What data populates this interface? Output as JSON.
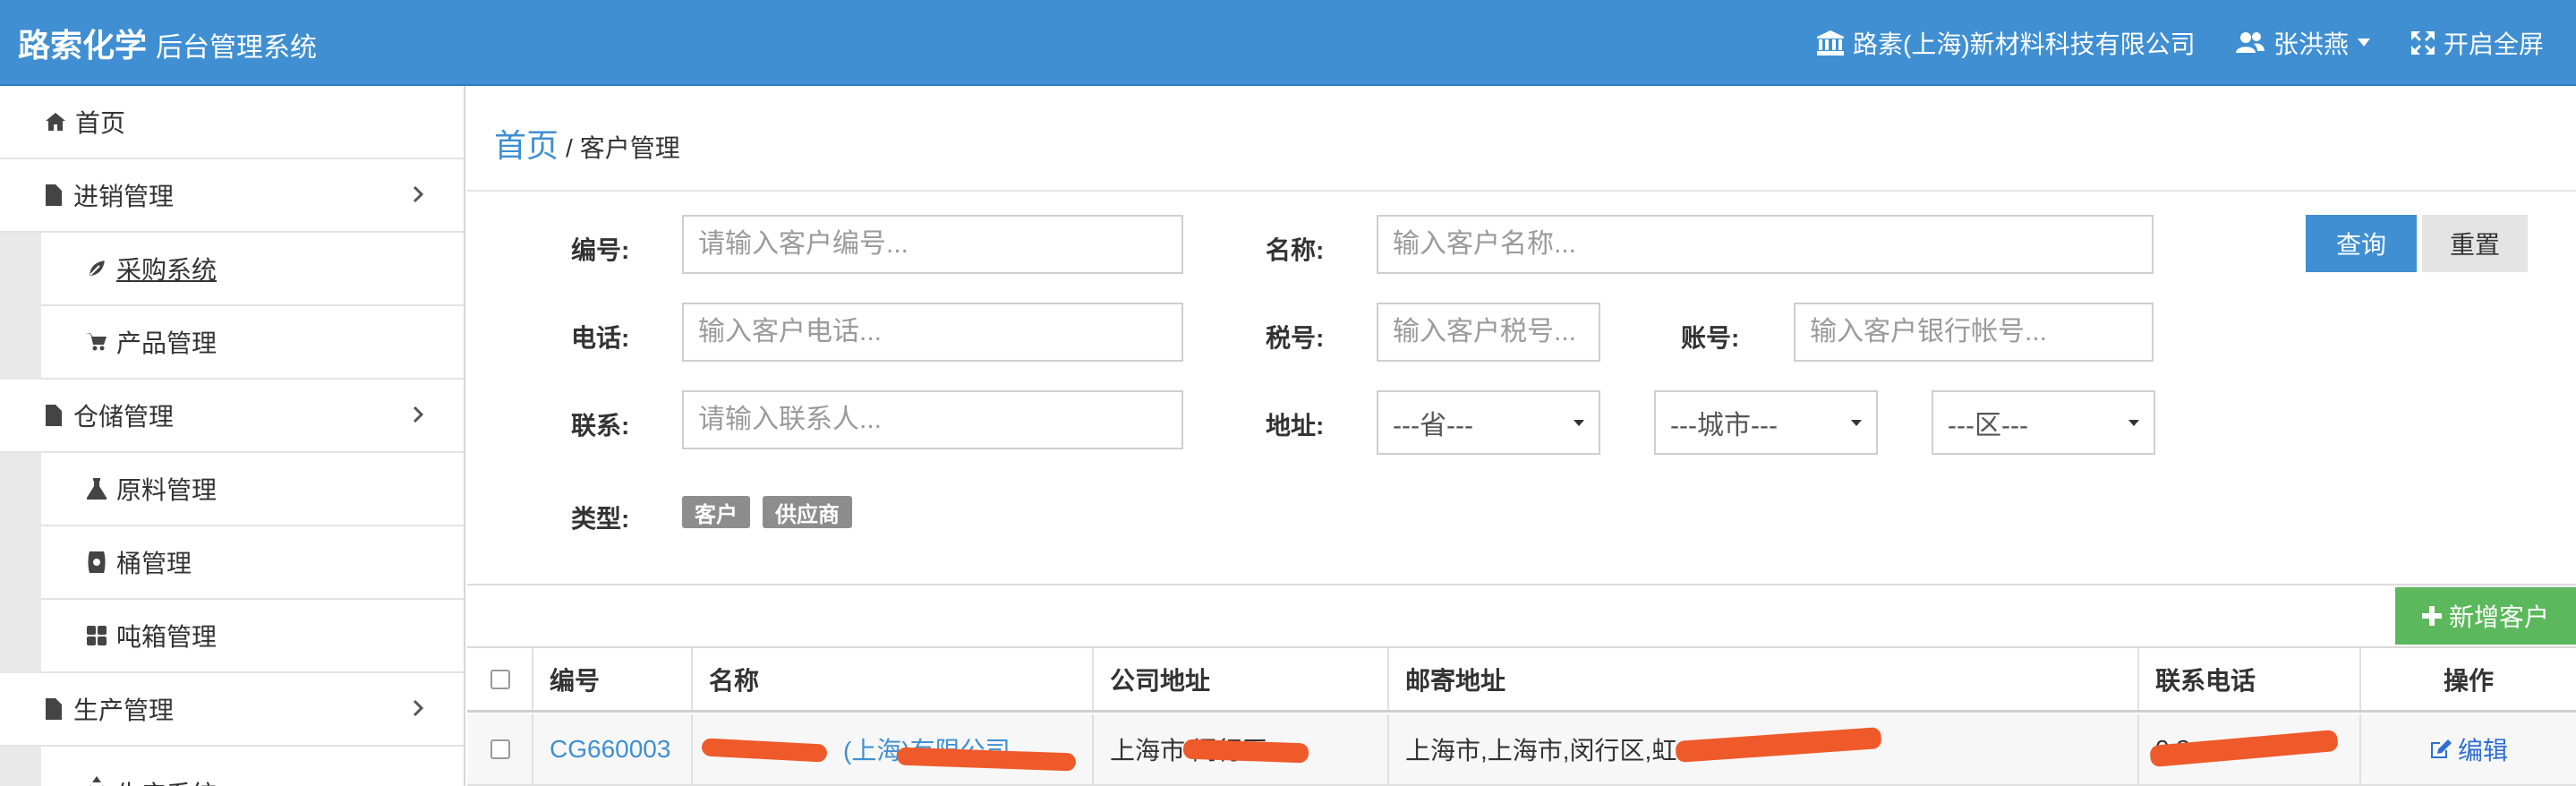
{
  "header": {
    "brand": "路索化学",
    "subtitle": "后台管理系统",
    "company": "路素(上海)新材料科技有限公司",
    "user": "张洪燕",
    "fullscreen": "开启全屏"
  },
  "sidebar": {
    "items": [
      {
        "label": "首页",
        "icon": "home-icon"
      },
      {
        "label": "进销管理",
        "icon": "file-icon"
      },
      {
        "label": "采购系统",
        "icon": "leaf-icon"
      },
      {
        "label": "产品管理",
        "icon": "cart-icon"
      },
      {
        "label": "仓储管理",
        "icon": "file-icon"
      },
      {
        "label": "原料管理",
        "icon": "flask-icon"
      },
      {
        "label": "桶管理",
        "icon": "barrel-icon"
      },
      {
        "label": "吨箱管理",
        "icon": "grid-icon"
      },
      {
        "label": "生产管理",
        "icon": "file-icon"
      },
      {
        "label": "生产系统",
        "icon": "recycle-icon"
      }
    ]
  },
  "breadcrumb": {
    "home": "首页",
    "separator": "/",
    "current": "客户管理"
  },
  "search": {
    "code_label": "编号:",
    "code_placeholder": "请输入客户编号...",
    "name_label": "名称:",
    "name_placeholder": "输入客户名称...",
    "phone_label": "电话:",
    "phone_placeholder": "输入客户电话...",
    "tax_label": "税号:",
    "tax_placeholder": "输入客户税号...",
    "account_label": "账号:",
    "account_placeholder": "输入客户银行帐号...",
    "contact_label": "联系:",
    "contact_placeholder": "请输入联系人...",
    "address_label": "地址:",
    "province": "---省---",
    "city": "---城市---",
    "district": "---区---",
    "type_label": "类型:",
    "types": [
      "客户",
      "供应商"
    ],
    "query_button": "查询",
    "reset_button": "重置"
  },
  "add_button": "新增客户",
  "table": {
    "headers": [
      "编号",
      "名称",
      "公司地址",
      "邮寄地址",
      "联系电话",
      "操作"
    ],
    "rows": [
      {
        "code": "CG660003",
        "name": "(上海)有限公司",
        "address": "上海市 闵行区",
        "mail": "上海市,上海市,闵行区,虹",
        "phone": "0 3",
        "action": "编辑"
      }
    ]
  },
  "colors": {
    "primary": "#3f8fd2",
    "success": "#5cb85c",
    "redaction": "#ee5a2a"
  }
}
